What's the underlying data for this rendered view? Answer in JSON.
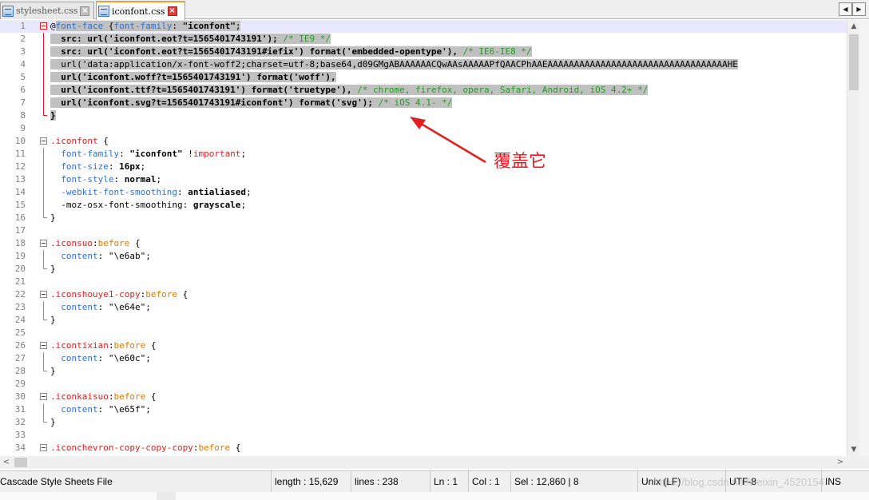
{
  "tabs": [
    {
      "label": "stylesheet.css",
      "active": false
    },
    {
      "label": "iconfont.css",
      "active": true
    }
  ],
  "nav_buttons": {
    "left": "◀",
    "right": "▶"
  },
  "code_lines": [
    {
      "num": "1",
      "selected": true,
      "segs": [
        {
          "t": "@",
          "c": "#000000",
          "b": false,
          "sel": false
        },
        {
          "t": "font-face",
          "c": "#3070d0",
          "b": false,
          "sel": true
        },
        {
          "t": " {",
          "c": "#000000",
          "b": false,
          "sel": true
        },
        {
          "t": "font-family",
          "c": "#3070d0",
          "b": false,
          "sel": true
        },
        {
          "t": ": ",
          "c": "#000000",
          "b": false,
          "sel": true
        },
        {
          "t": "\"iconfont\"",
          "c": "#000000",
          "b": true,
          "sel": true
        },
        {
          "t": ";",
          "c": "#000000",
          "b": false,
          "sel": true
        }
      ]
    },
    {
      "num": "2",
      "selected": true,
      "segs": [
        {
          "t": "  src: url('iconfont.eot?t=1565401743191'); ",
          "c": "#000000",
          "b": true,
          "sel": true
        },
        {
          "t": "/* IE9 */",
          "c": "#20a020",
          "b": false,
          "sel": true
        }
      ]
    },
    {
      "num": "3",
      "selected": true,
      "segs": [
        {
          "t": "  src: url('iconfont.eot?t=1565401743191#iefix') format('embedded-opentype'), ",
          "c": "#000000",
          "b": true,
          "sel": true
        },
        {
          "t": "/* IE6-IE8 */",
          "c": "#20a020",
          "b": false,
          "sel": true
        }
      ]
    },
    {
      "num": "4",
      "selected": true,
      "segs": [
        {
          "t": "  url('data:application/x-font-woff2;charset=utf-8;base64,d09GMgABAAAAAACQwAAsAAAAAPfQAACPhAAEAAAAAAAAAAAAAAAAAAAAAAAAAAAAAAAAAAHE",
          "c": "#000000",
          "b": false,
          "sel": true
        }
      ]
    },
    {
      "num": "5",
      "selected": true,
      "segs": [
        {
          "t": "  url('iconfont.woff?t=1565401743191') format('woff'),",
          "c": "#000000",
          "b": true,
          "sel": true
        }
      ]
    },
    {
      "num": "6",
      "selected": true,
      "segs": [
        {
          "t": "  url('iconfont.ttf?t=1565401743191') format('truetype'), ",
          "c": "#000000",
          "b": true,
          "sel": true
        },
        {
          "t": "/* chrome, firefox, opera, Safari, Android, iOS 4.2+ */",
          "c": "#20a020",
          "b": false,
          "sel": true
        }
      ]
    },
    {
      "num": "7",
      "selected": true,
      "segs": [
        {
          "t": "  url('iconfont.svg?t=1565401743191#iconfont') format('svg'); ",
          "c": "#000000",
          "b": true,
          "sel": true
        },
        {
          "t": "/* iOS 4.1- */",
          "c": "#20a020",
          "b": false,
          "sel": true
        }
      ]
    },
    {
      "num": "8",
      "selected": false,
      "segs": [
        {
          "t": "}",
          "c": "#000000",
          "b": true,
          "sel": true
        }
      ]
    },
    {
      "num": "9",
      "selected": false,
      "segs": []
    },
    {
      "num": "10",
      "selected": false,
      "segs": [
        {
          "t": ".iconfont",
          "c": "#e02020",
          "b": false,
          "sel": false
        },
        {
          "t": " {",
          "c": "#000000",
          "b": false,
          "sel": false
        }
      ]
    },
    {
      "num": "11",
      "selected": false,
      "segs": [
        {
          "t": "  font-family",
          "c": "#3070d0",
          "b": false,
          "sel": false
        },
        {
          "t": ": ",
          "c": "#000000",
          "b": false,
          "sel": false
        },
        {
          "t": "\"iconfont\"",
          "c": "#000000",
          "b": true,
          "sel": false
        },
        {
          "t": " !",
          "c": "#000000",
          "b": false,
          "sel": false
        },
        {
          "t": "important",
          "c": "#e02020",
          "b": false,
          "sel": false
        },
        {
          "t": ";",
          "c": "#000000",
          "b": false,
          "sel": false
        }
      ]
    },
    {
      "num": "12",
      "selected": false,
      "segs": [
        {
          "t": "  font-size",
          "c": "#3070d0",
          "b": false,
          "sel": false
        },
        {
          "t": ": ",
          "c": "#000000",
          "b": false,
          "sel": false
        },
        {
          "t": "16px",
          "c": "#000000",
          "b": true,
          "sel": false
        },
        {
          "t": ";",
          "c": "#000000",
          "b": false,
          "sel": false
        }
      ]
    },
    {
      "num": "13",
      "selected": false,
      "segs": [
        {
          "t": "  font-style",
          "c": "#3070d0",
          "b": false,
          "sel": false
        },
        {
          "t": ": ",
          "c": "#000000",
          "b": false,
          "sel": false
        },
        {
          "t": "normal",
          "c": "#000000",
          "b": true,
          "sel": false
        },
        {
          "t": ";",
          "c": "#000000",
          "b": false,
          "sel": false
        }
      ]
    },
    {
      "num": "14",
      "selected": false,
      "segs": [
        {
          "t": "  -webkit-font-smoothing",
          "c": "#3070d0",
          "b": false,
          "sel": false
        },
        {
          "t": ": ",
          "c": "#000000",
          "b": false,
          "sel": false
        },
        {
          "t": "antialiased",
          "c": "#000000",
          "b": true,
          "sel": false
        },
        {
          "t": ";",
          "c": "#000000",
          "b": false,
          "sel": false
        }
      ]
    },
    {
      "num": "15",
      "selected": false,
      "segs": [
        {
          "t": "  -moz-osx-font-smoothing",
          "c": "#000000",
          "b": false,
          "sel": false
        },
        {
          "t": ": ",
          "c": "#000000",
          "b": false,
          "sel": false
        },
        {
          "t": "grayscale",
          "c": "#000000",
          "b": true,
          "sel": false
        },
        {
          "t": ";",
          "c": "#000000",
          "b": false,
          "sel": false
        }
      ]
    },
    {
      "num": "16",
      "selected": false,
      "segs": [
        {
          "t": "}",
          "c": "#000000",
          "b": false,
          "sel": false
        }
      ]
    },
    {
      "num": "17",
      "selected": false,
      "segs": []
    },
    {
      "num": "18",
      "selected": false,
      "segs": [
        {
          "t": ".iconsuo",
          "c": "#e02020",
          "b": false,
          "sel": false
        },
        {
          "t": ":",
          "c": "#000000",
          "b": false,
          "sel": false
        },
        {
          "t": "before",
          "c": "#e07b00",
          "b": false,
          "sel": false
        },
        {
          "t": " {",
          "c": "#000000",
          "b": false,
          "sel": false
        }
      ]
    },
    {
      "num": "19",
      "selected": false,
      "segs": [
        {
          "t": "  content",
          "c": "#3070d0",
          "b": false,
          "sel": false
        },
        {
          "t": ": ",
          "c": "#000000",
          "b": false,
          "sel": false
        },
        {
          "t": "\"\\e6ab\"",
          "c": "#000000",
          "b": false,
          "sel": false
        },
        {
          "t": ";",
          "c": "#000000",
          "b": false,
          "sel": false
        }
      ]
    },
    {
      "num": "20",
      "selected": false,
      "segs": [
        {
          "t": "}",
          "c": "#000000",
          "b": false,
          "sel": false
        }
      ]
    },
    {
      "num": "21",
      "selected": false,
      "segs": []
    },
    {
      "num": "22",
      "selected": false,
      "segs": [
        {
          "t": ".iconshouye1-copy",
          "c": "#e02020",
          "b": false,
          "sel": false
        },
        {
          "t": ":",
          "c": "#000000",
          "b": false,
          "sel": false
        },
        {
          "t": "before",
          "c": "#e07b00",
          "b": false,
          "sel": false
        },
        {
          "t": " {",
          "c": "#000000",
          "b": false,
          "sel": false
        }
      ]
    },
    {
      "num": "23",
      "selected": false,
      "segs": [
        {
          "t": "  content",
          "c": "#3070d0",
          "b": false,
          "sel": false
        },
        {
          "t": ": ",
          "c": "#000000",
          "b": false,
          "sel": false
        },
        {
          "t": "\"\\e64e\"",
          "c": "#000000",
          "b": false,
          "sel": false
        },
        {
          "t": ";",
          "c": "#000000",
          "b": false,
          "sel": false
        }
      ]
    },
    {
      "num": "24",
      "selected": false,
      "segs": [
        {
          "t": "}",
          "c": "#000000",
          "b": false,
          "sel": false
        }
      ]
    },
    {
      "num": "25",
      "selected": false,
      "segs": []
    },
    {
      "num": "26",
      "selected": false,
      "segs": [
        {
          "t": ".icontixian",
          "c": "#e02020",
          "b": false,
          "sel": false
        },
        {
          "t": ":",
          "c": "#000000",
          "b": false,
          "sel": false
        },
        {
          "t": "before",
          "c": "#e07b00",
          "b": false,
          "sel": false
        },
        {
          "t": " {",
          "c": "#000000",
          "b": false,
          "sel": false
        }
      ]
    },
    {
      "num": "27",
      "selected": false,
      "segs": [
        {
          "t": "  content",
          "c": "#3070d0",
          "b": false,
          "sel": false
        },
        {
          "t": ": ",
          "c": "#000000",
          "b": false,
          "sel": false
        },
        {
          "t": "\"\\e60c\"",
          "c": "#000000",
          "b": false,
          "sel": false
        },
        {
          "t": ";",
          "c": "#000000",
          "b": false,
          "sel": false
        }
      ]
    },
    {
      "num": "28",
      "selected": false,
      "segs": [
        {
          "t": "}",
          "c": "#000000",
          "b": false,
          "sel": false
        }
      ]
    },
    {
      "num": "29",
      "selected": false,
      "segs": []
    },
    {
      "num": "30",
      "selected": false,
      "segs": [
        {
          "t": ".iconkaisuo",
          "c": "#e02020",
          "b": false,
          "sel": false
        },
        {
          "t": ":",
          "c": "#000000",
          "b": false,
          "sel": false
        },
        {
          "t": "before",
          "c": "#e07b00",
          "b": false,
          "sel": false
        },
        {
          "t": " {",
          "c": "#000000",
          "b": false,
          "sel": false
        }
      ]
    },
    {
      "num": "31",
      "selected": false,
      "segs": [
        {
          "t": "  content",
          "c": "#3070d0",
          "b": false,
          "sel": false
        },
        {
          "t": ": ",
          "c": "#000000",
          "b": false,
          "sel": false
        },
        {
          "t": "\"\\e65f\"",
          "c": "#000000",
          "b": false,
          "sel": false
        },
        {
          "t": ";",
          "c": "#000000",
          "b": false,
          "sel": false
        }
      ]
    },
    {
      "num": "32",
      "selected": false,
      "segs": [
        {
          "t": "}",
          "c": "#000000",
          "b": false,
          "sel": false
        }
      ]
    },
    {
      "num": "33",
      "selected": false,
      "segs": []
    },
    {
      "num": "34",
      "selected": false,
      "segs": [
        {
          "t": ".iconchevron-copy-copy-copy",
          "c": "#e02020",
          "b": false,
          "sel": false
        },
        {
          "t": ":",
          "c": "#000000",
          "b": false,
          "sel": false
        },
        {
          "t": "before",
          "c": "#e07b00",
          "b": false,
          "sel": false
        },
        {
          "t": " {",
          "c": "#000000",
          "b": false,
          "sel": false
        }
      ]
    }
  ],
  "annotation": {
    "text": "覆盖它",
    "color": "#e02020"
  },
  "status": {
    "file_type": "Cascade Style Sheets File",
    "length": "length : 15,629",
    "lines": "lines : 238",
    "ln": "Ln : 1",
    "col": "Col : 1",
    "sel": "Sel : 12,860 | 8",
    "eol": "Unix (LF)",
    "encoding": "UTF-8",
    "mode": "INS"
  },
  "watermark": "https://blog.csdn.net/weixin_4520154",
  "colors": {
    "selection": "#c0c0c0",
    "keyword_blue": "#3070d0",
    "selector_red": "#e02020",
    "pseudo_orange": "#e07b00",
    "comment_green": "#20a020",
    "active_tab_accent": "#f0a030"
  },
  "icons": [
    "file-icon",
    "close-icon",
    "scroll-left-icon",
    "scroll-right-icon",
    "scroll-up-icon",
    "scroll-down-icon",
    "fold-minus-icon"
  ]
}
